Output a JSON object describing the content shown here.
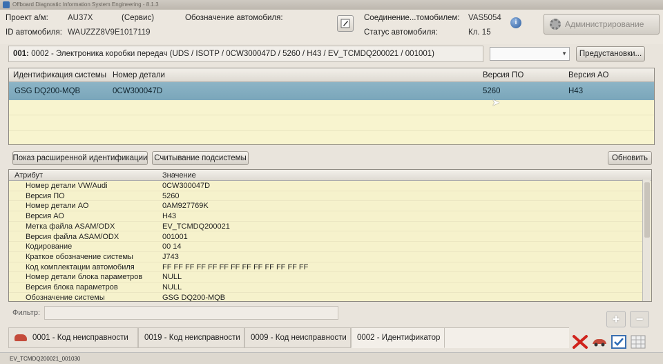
{
  "window": {
    "title": "Offboard Diagnostic Information System Engineering - 8.1.3"
  },
  "header": {
    "project_label": "Проект а/м:",
    "project_value": "AU37X",
    "service_label": "(Сервис)",
    "designation_label": "Обозначение автомобиля:",
    "vehicle_id_label": "ID автомобиля:",
    "vehicle_id_value": "WAUZZZ8V9E1017119",
    "connection_label": "Соединение...томобилем:",
    "connection_value": "VAS5054",
    "status_label": "Статус автомобиля:",
    "status_value": "Кл. 15",
    "admin_label": "Администрирование"
  },
  "path": {
    "number": "001:",
    "text": "0002 - Электроника коробки передач (UDS / ISOTP / 0CW300047D / 5260 / H43 / EV_TCMDQ200021 / 001001)"
  },
  "presets_label": "Предустановки...",
  "ident_table": {
    "columns": [
      "Идентификация системы",
      "Номер детали",
      "Версия ПО",
      "Версия АО"
    ],
    "row": [
      "GSG DQ200-MQB",
      "0CW300047D",
      "5260",
      "H43"
    ]
  },
  "buttons": {
    "extended_ident": "Показ расширенной идентификации",
    "subsystem_read": "Считывание подсистемы",
    "refresh": "Обновить"
  },
  "attr_table": {
    "columns": [
      "Атрибут",
      "Значение"
    ],
    "rows": [
      {
        "attr": "Номер детали VW/Audi",
        "value": "0CW300047D"
      },
      {
        "attr": "Версия ПО",
        "value": "5260"
      },
      {
        "attr": "Номер детали АО",
        "value": "0AM927769K"
      },
      {
        "attr": "Версия АО",
        "value": "H43"
      },
      {
        "attr": "Метка файла ASAM/ODX",
        "value": "EV_TCMDQ200021"
      },
      {
        "attr": "Версия файла ASAM/ODX",
        "value": "001001"
      },
      {
        "attr": "Кодирование",
        "value": "00 14"
      },
      {
        "attr": "Краткое обозначение системы",
        "value": "J743"
      },
      {
        "attr": "Код комплектации автомобиля",
        "value": "FF FF FF FF FF FF FF FF FF FF FF FF FF"
      },
      {
        "attr": "Номер детали блока параметров",
        "value": "NULL"
      },
      {
        "attr": "Версия блока параметров",
        "value": "NULL"
      },
      {
        "attr": "Обозначение системы",
        "value": "GSG DQ200-MQB"
      }
    ]
  },
  "filter": {
    "label": "Фильтр:",
    "value": ""
  },
  "tabs": [
    {
      "label": "0001 - Код неисправности"
    },
    {
      "label": "0019 - Код неисправности"
    },
    {
      "label": "0009 - Код неисправности"
    },
    {
      "label": "0002 - Идентификатор"
    }
  ],
  "statusbar": {
    "text": "EV_TCMDQ200021_001030"
  }
}
